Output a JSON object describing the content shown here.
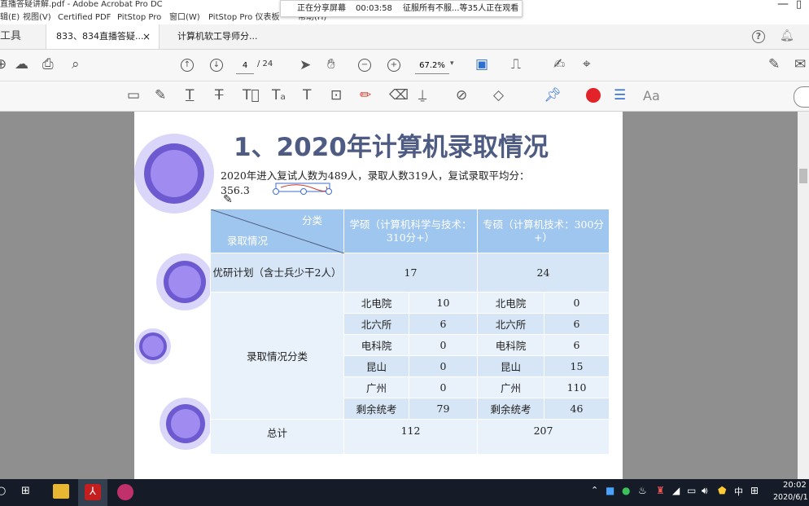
{
  "window": {
    "title": "直播答疑讲解.pdf - Adobe Acrobat Pro DC",
    "menu": [
      "辑(E)",
      "视图(V)",
      "Certified PDF",
      "PitStop Pro",
      "窗口(W)",
      "PitStop Pro 仪表板",
      "帮助(H)"
    ]
  },
  "share_banner": {
    "status": "正在分享屏幕",
    "duration": "00:03:58",
    "viewers": "征服所有不服...等35人正在观看"
  },
  "tabs": {
    "tools": "工具",
    "doc1": "833、834直播答疑...",
    "doc1_close": "×",
    "doc2": "计算机软工导师分..."
  },
  "toolbar": {
    "page_current": "4",
    "page_total": "/ 24",
    "zoom": "67.2%",
    "zoom_dropdown": "▾"
  },
  "toolbar2": {
    "font_label": "Aa",
    "color_accent": "#e3232a"
  },
  "page": {
    "heading": "1、2020年计算机录取情况",
    "intro_line1": "2020年进入复试人数为489人，录取人数319人，复试录取平均分：",
    "intro_line2": "356.3",
    "table": {
      "header_diag_top": "分类",
      "header_diag_bottom": "录取情况",
      "header_academic": "学硕（计算机科学与技术：310分+）",
      "header_professional": "专硕（计算机技术：300分+）",
      "row_plan_label": "优研计划（含士兵少干2人）",
      "row_plan_academic": "17",
      "row_plan_professional": "24",
      "group_label": "录取情况分类",
      "sub_rows": [
        {
          "a_name": "北电院",
          "a_val": "10",
          "p_name": "北电院",
          "p_val": "0"
        },
        {
          "a_name": "北六所",
          "a_val": "6",
          "p_name": "北六所",
          "p_val": "6"
        },
        {
          "a_name": "电科院",
          "a_val": "0",
          "p_name": "电科院",
          "p_val": "6"
        },
        {
          "a_name": "昆山",
          "a_val": "0",
          "p_name": "昆山",
          "p_val": "15"
        },
        {
          "a_name": "广州",
          "a_val": "0",
          "p_name": "广州",
          "p_val": "110"
        },
        {
          "a_name": "剩余统考",
          "a_val": "79",
          "p_name": "剩余统考",
          "p_val": "46"
        }
      ],
      "total_label": "总计",
      "total_academic": "112",
      "total_professional": "207"
    }
  },
  "taskbar": {
    "ime": "中",
    "time": "20:02",
    "date": "2020/6/1"
  }
}
